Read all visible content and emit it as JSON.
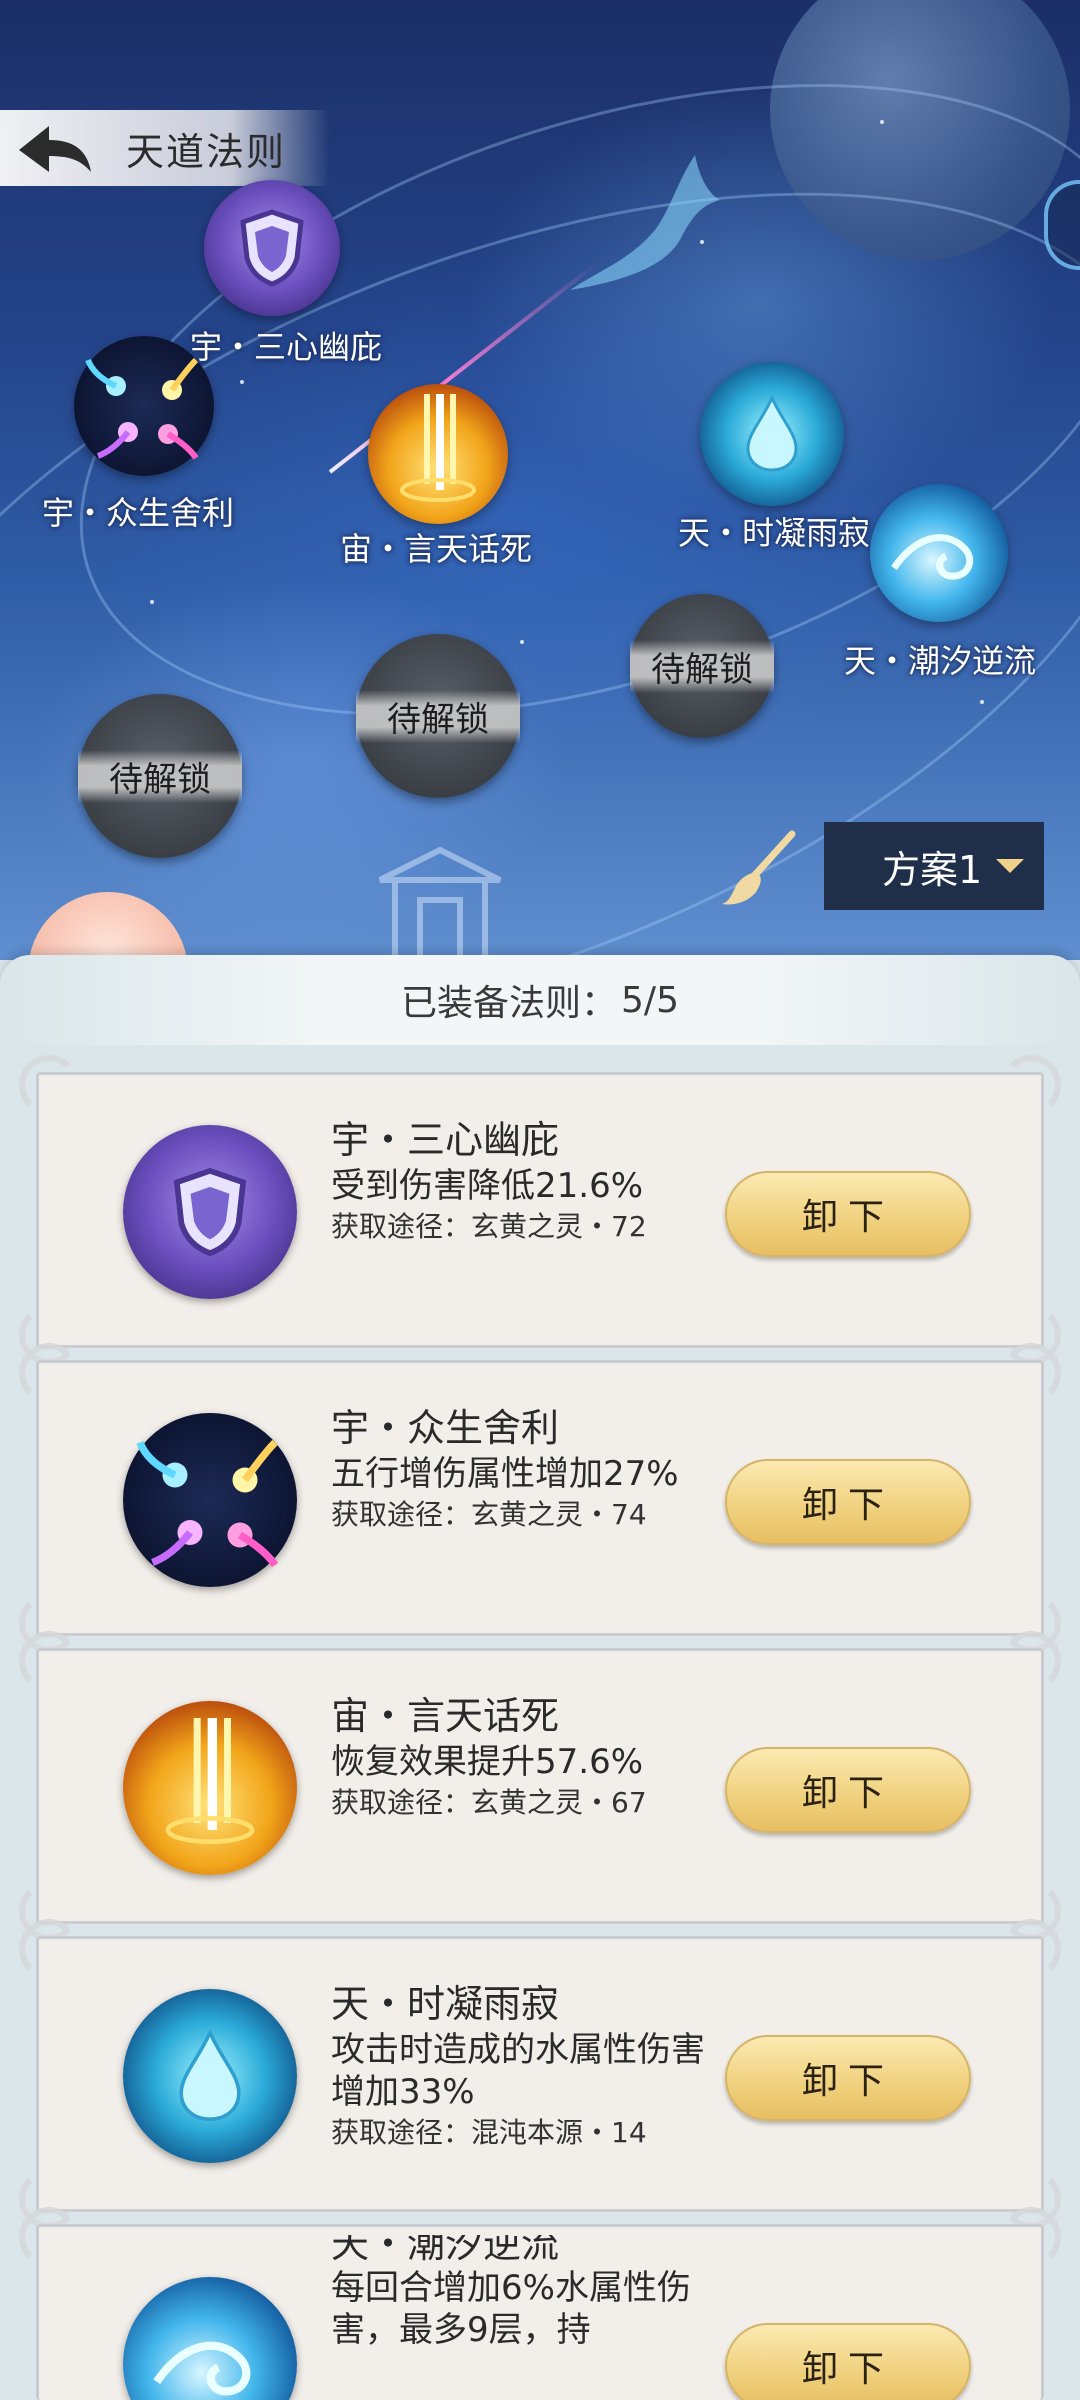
{
  "header": {
    "title": "天道法则"
  },
  "map_nodes": [
    {
      "label": "宇・三心幽庇"
    },
    {
      "label": "宇・众生舍利"
    },
    {
      "label": "宙・言天话死"
    },
    {
      "label": "天・时凝雨寂"
    },
    {
      "label": "天・潮汐逆流"
    }
  ],
  "locked_label": "待解锁",
  "scheme": {
    "label": "方案1"
  },
  "panel": {
    "equipped_label": "已装备法则：",
    "equipped_count": "5/5"
  },
  "unequip_label": "卸下",
  "cards": [
    {
      "name": "宇・三心幽庇",
      "effect": "受到伤害降低21.6%",
      "source": "获取途径：玄黄之灵・72"
    },
    {
      "name": "宇・众生舍利",
      "effect": "五行增伤属性增加27%",
      "source": "获取途径：玄黄之灵・74"
    },
    {
      "name": "宙・言天话死",
      "effect": "恢复效果提升57.6%",
      "source": "获取途径：玄黄之灵・67"
    },
    {
      "name": "天・时凝雨寂",
      "effect": "攻击时造成的水属性伤害增加33%",
      "source": "获取途径：混沌本源・14"
    },
    {
      "name": "天・潮汐逆流",
      "effect": "每回合增加6%水属性伤害，最多9层，持",
      "source": ""
    }
  ],
  "colors": {
    "scheme_bg": "#1f2f49",
    "button_gold": "#f0d07c",
    "card_bg": "#f2eee9"
  }
}
